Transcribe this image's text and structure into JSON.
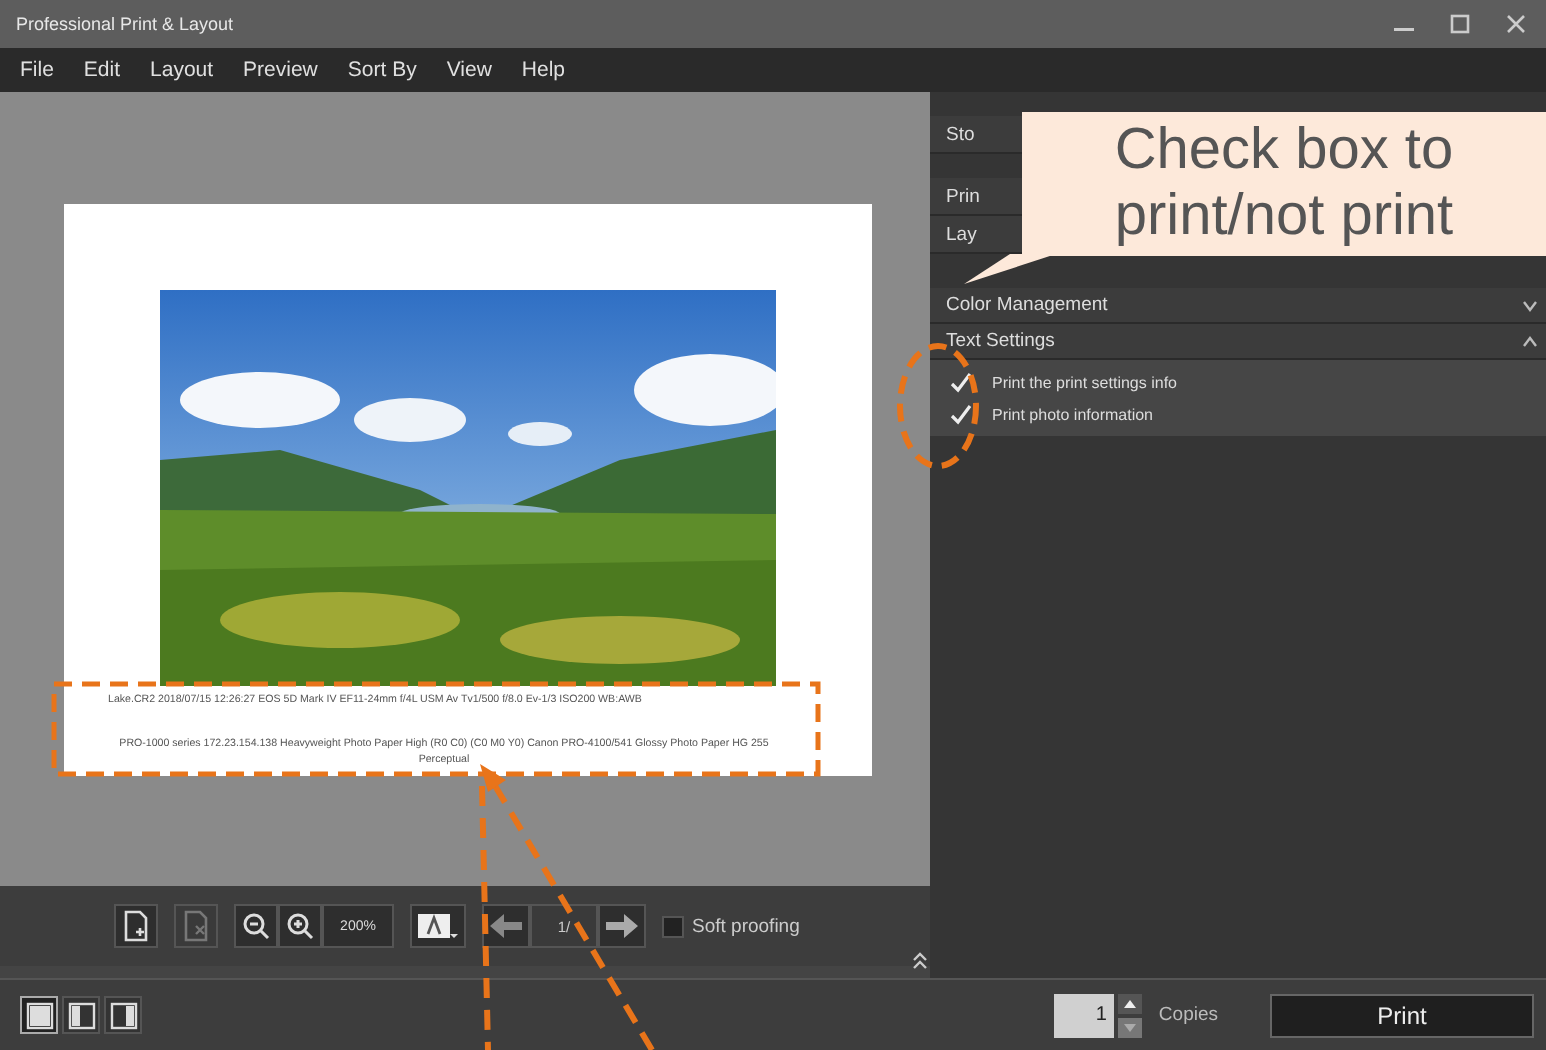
{
  "window": {
    "title": "Professional Print & Layout"
  },
  "menu": [
    "File",
    "Edit",
    "Layout",
    "Preview",
    "Sort By",
    "View",
    "Help"
  ],
  "preview": {
    "photo": {
      "kind": "picture"
    },
    "print_lines": [
      "Lake.CR2 2018/07/15 12:26:27 EOS 5D Mark IV EF11-24mm f/4L USM Av Tv1/500 f/8.0 Ev-1/3 ISO200 WB:AWB",
      "PRO-1000 series 172.23.154.138 Heavyweight Photo Paper High (R0 C0) (C0 M0 Y0) Canon PRO-4100/541 Glossy Photo Paper HG 255 Perceptual"
    ]
  },
  "toolbar": {
    "zoom": "200%",
    "page": "1/",
    "soft_proofing": {
      "label": "Soft proofing",
      "checked": false
    }
  },
  "panel": {
    "partial_rows": [
      "Sto",
      "Prin",
      "Lay"
    ],
    "sections": [
      {
        "label": "Color Management",
        "expanded": false
      },
      {
        "label": "Text Settings",
        "expanded": true,
        "options": [
          {
            "label": "Print the print settings info",
            "checked": true
          },
          {
            "label": "Print photo information",
            "checked": true
          }
        ]
      }
    ]
  },
  "bottom": {
    "layouts": [
      {
        "selected": true
      },
      {
        "selected": false
      },
      {
        "selected": false
      }
    ],
    "copies": "1",
    "copies_label": "Copies",
    "print": "Print"
  },
  "annotation": {
    "text": "Check box to print/not print"
  }
}
